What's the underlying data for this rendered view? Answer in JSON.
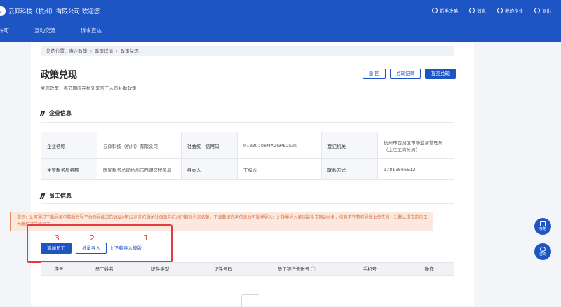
{
  "header": {
    "brand": "云仰科技（杭州）有限公司 欢迎您",
    "top_links": [
      {
        "label": "新手攻略",
        "icon": "guide-icon"
      },
      {
        "label": "消息",
        "icon": "message-icon"
      },
      {
        "label": "我的企业",
        "icon": "company-icon"
      },
      {
        "label": "退出",
        "icon": "logout-icon"
      }
    ],
    "nav": [
      "许可",
      "互动交流",
      "诉求直达"
    ]
  },
  "breadcrumb": {
    "prefix": "您的位置：",
    "items": [
      "惠企政策",
      "政策详情",
      "政策兑现"
    ]
  },
  "page": {
    "title": "政策兑现",
    "subtitle": "兑现政策：春节期间在杭外来务工人员补助政策",
    "buttons": {
      "back": "返 回",
      "records": "兑现记录",
      "submit": "提交兑现"
    }
  },
  "company_section": {
    "title": "企业信息",
    "rows": [
      [
        {
          "k": "企业名称",
          "v": "云仰科技（杭州）有限公司"
        },
        {
          "k": "社会统一信用码",
          "v": "91330108MA2GPB2E90"
        },
        {
          "k": "登记机关",
          "v": "杭州市西湖区市场监督管理局（之江工商分局）"
        }
      ],
      [
        {
          "k": "主管税务局名称",
          "v": "国家税务总局杭州市西湖区税务局"
        },
        {
          "k": "经办人",
          "v": "丁权永"
        },
        {
          "k": "联系方式",
          "v": "17816866512"
        }
      ]
    ]
  },
  "staff_section": {
    "title": "员工信息",
    "tip": "提示：1.可通过下载导单电脑版后导平台预导截过的2020年12月在杭缴纳社保且非杭州户籍的人员名单，下载数据完善信息后可批量导入；2.批量导入单次最多支持200条，信息不完整将导致上传失败；3.默认提交的员工为缴杭过节的员工。",
    "actions": {
      "add": "添加员工",
      "import": "批量导入",
      "download": "下载导入模版"
    },
    "annotations": [
      "3",
      "2",
      "1"
    ],
    "columns": [
      "序号",
      "员工姓名",
      "证件类型",
      "证件号码",
      "员工银行卡账号",
      "手机号",
      "操作"
    ]
  },
  "floating": [
    {
      "label": "攻略",
      "icon": "guide-float-icon"
    },
    {
      "label": "咨询",
      "icon": "consult-icon"
    }
  ]
}
